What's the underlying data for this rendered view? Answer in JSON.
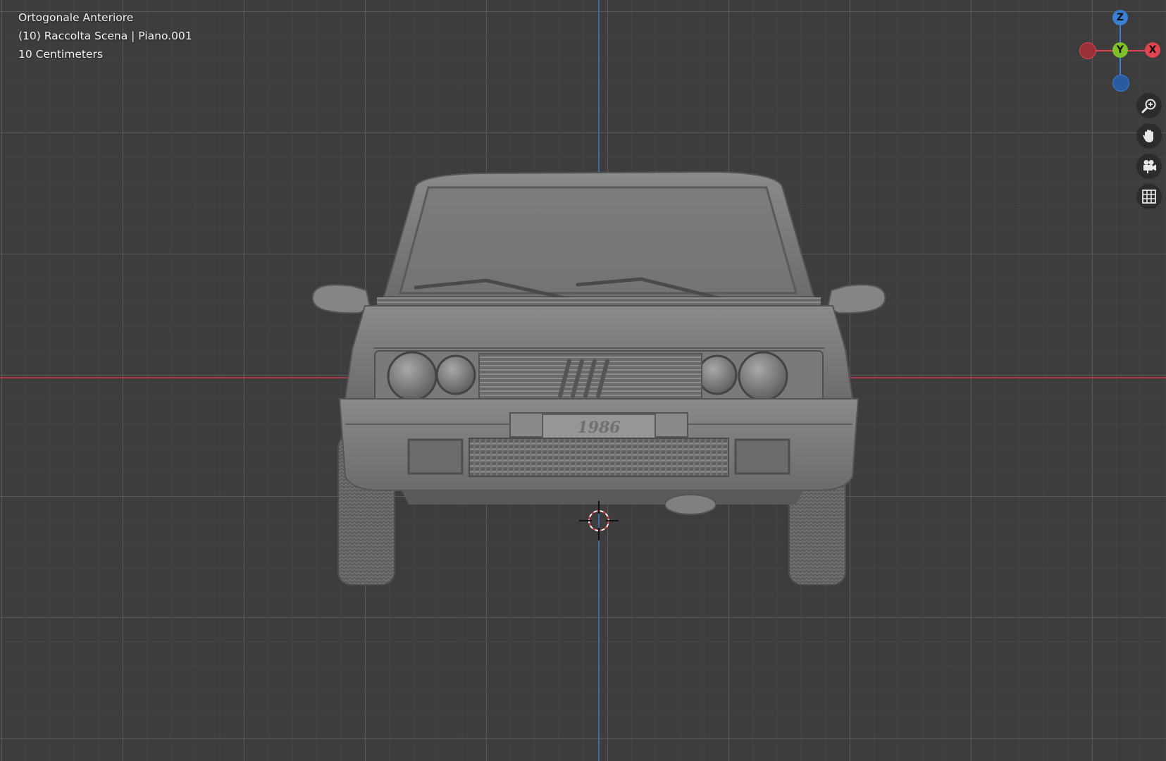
{
  "viewport": {
    "view_name": "Ortogonale Anteriore",
    "collection_info": "(10) Raccolta Scena | Piano.001",
    "grid_scale": "10 Centimeters",
    "background_color": "#3d3d3d"
  },
  "gizmo": {
    "z_label": "Z",
    "y_label": "Y",
    "x_label": "X",
    "colors": {
      "x": "#e0444f",
      "y": "#7fbf2a",
      "z": "#3a7fd6",
      "neg_x": "#9a3038",
      "neg_z": "#2a5aa0"
    }
  },
  "nav_buttons": [
    {
      "name": "zoom",
      "icon": "zoom-in-icon"
    },
    {
      "name": "pan",
      "icon": "hand-icon"
    },
    {
      "name": "camera",
      "icon": "camera-icon"
    },
    {
      "name": "orthographic",
      "icon": "grid-icon"
    }
  ],
  "model": {
    "plate_text": "1986"
  }
}
